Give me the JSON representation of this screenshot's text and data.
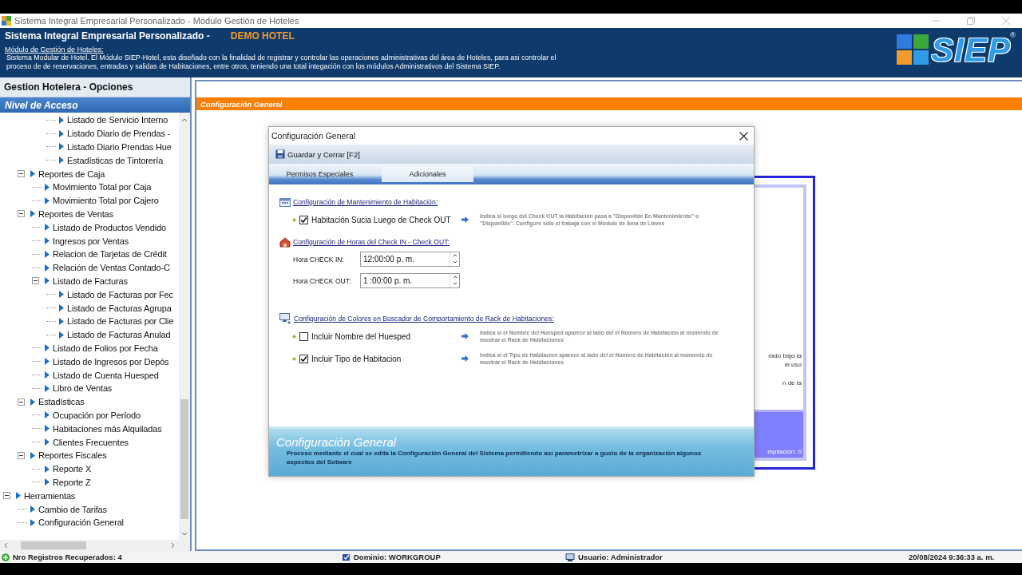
{
  "window": {
    "title": "Sistema Integral Empresarial Personalizado - Módulo Gestión de Hoteles"
  },
  "header": {
    "title": "Sistema Integral Empresarial Personalizado -",
    "company": "DEMO HOTEL",
    "module_title": "Módulo de Gestión de Hoteles:",
    "description": "Sistema Modular de Hotel.  El Módulo SIEP-Hotel, esta diseñado con la finalidad de registrar y controlar las operaciones administrativas del área de Hoteles, para asi controlar el proceso de de reservaciones, entradas y salidas de Habitaciones, entre otros, teniendo una total integación con los módulos Administrativos del Sistema SIEP.",
    "logo": "SIEP",
    "logo_mark": "®"
  },
  "sidebar": {
    "title": "Gestion Hotelera - Opciones",
    "section": "Nivel de Acceso",
    "tree": [
      {
        "children": [
          {
            "children": [
              {
                "children": [
                  {
                    "label": "Listado de Servicio Interno"
                  },
                  {
                    "label": "Listado Diario de Prendas -"
                  },
                  {
                    "label": "Listado Diario Prendas Hue"
                  },
                  {
                    "label": "Estadísticas de Tintorería"
                  }
                ]
              }
            ]
          },
          {
            "label": "Reportes de Caja",
            "expanded": true,
            "children": [
              {
                "label": "Movimiento Total por Caja"
              },
              {
                "label": "Movimiento Total por Cajero"
              }
            ]
          },
          {
            "label": "Reportes de Ventas",
            "expanded": true,
            "children": [
              {
                "label": "Listado de Productos Vendido"
              },
              {
                "label": "Ingresos por Ventas"
              },
              {
                "label": "Relacion de Tarjetas de Crédit"
              },
              {
                "label": "Relación de Ventas Contado-C"
              },
              {
                "label": "Listado de Facturas",
                "expanded": true,
                "children": [
                  {
                    "label": "Listado de Facturas por Fec"
                  },
                  {
                    "label": "Listado de Facturas Agrupa"
                  },
                  {
                    "label": "Listado de Facturas por Clie"
                  },
                  {
                    "label": "Listado de Facturas Anulad"
                  }
                ]
              },
              {
                "label": "Listado de Folios por Fecha"
              },
              {
                "label": "Listado de Ingresos por Depós"
              },
              {
                "label": "Listado de Cuenta Huesped"
              },
              {
                "label": "Libro de Ventas"
              }
            ]
          },
          {
            "label": "Estadísticas",
            "expanded": true,
            "children": [
              {
                "label": "Ocupación por Período"
              },
              {
                "label": "Habitaciones más Alquiladas"
              },
              {
                "label": "Clientes Frecuentes"
              }
            ]
          },
          {
            "label": "Reportes Fiscales",
            "expanded": true,
            "children": [
              {
                "label": "Reporte X"
              },
              {
                "label": "Reporte Z"
              }
            ]
          }
        ]
      },
      {
        "label": "Herramientas",
        "expanded": true,
        "children": [
          {
            "label": "Cambio de Tarifas"
          },
          {
            "label": "Configuración General"
          }
        ]
      }
    ]
  },
  "content": {
    "title": "Configuración General",
    "background_panel": {
      "lines": [
        "rado bajo la",
        "el uso",
        "n de la"
      ],
      "footer": "mpilación: 0"
    }
  },
  "dialog": {
    "title": "Configuración General",
    "toolbar": [
      {
        "label": "Guardar y Cerrar [F2]"
      }
    ],
    "tabs": [
      {
        "label": "Permisos Especiales",
        "selected": false
      },
      {
        "label": "Adicionales",
        "selected": true
      }
    ],
    "sections": [
      {
        "kind": "options",
        "heading": "Configuración de Mantenimiento de Habitación:",
        "options": [
          {
            "label": "Habitación Sucia Luego de Check OUT",
            "checked": true,
            "description": "Indica si luego del Check OUT la Habitación pasa a \"Disponible En Mantenimiento\" o \"Disponible\". Configure solo si trabaja con el Módulo de Ama de Llaves"
          }
        ]
      },
      {
        "kind": "times",
        "heading": "Configuración de Horas del Check IN - Check OUT:",
        "fields": [
          {
            "label": "Hora CHECK IN:",
            "value": "12:00:00 p. m."
          },
          {
            "label": "Hora CHECK OUT:",
            "value": "1 :00:00 p. m."
          }
        ]
      },
      {
        "kind": "options",
        "heading": "Configuración de Colores en Buscador de Comportamiento de Rack de Habitaciones:",
        "options": [
          {
            "label": "Incluir Nombre del Huesped",
            "checked": false,
            "description": "Indica si el Nombre del Huesped aparece al lado del el Número de Habitación al momento de mostrar el Rack de Habitaciones"
          },
          {
            "label": "Incluir Tipo de Habitacion",
            "checked": true,
            "description": "Indica si el Tipo de Habitacion aparece al lado del el Número de Habitación al momento de mostrar el Rack de Habitaciones"
          }
        ]
      }
    ],
    "footer": {
      "title": "Configuración General",
      "description": "Proceso mediante el cual se edita la Configuración General del Sistema permitiendo así parametrizar a gusto de la organización algunos aspectos del Sotware"
    }
  },
  "status_bar": [
    {
      "kind": "records",
      "text": "Nro Registros Recuperados: 4"
    },
    {
      "kind": "domain",
      "text": "Dominio: WORKGROUP"
    },
    {
      "kind": "user",
      "text": "Usuario: Administrador"
    },
    {
      "kind": "datetime",
      "text": "20/08/2024 9:36:33 a. m."
    }
  ]
}
